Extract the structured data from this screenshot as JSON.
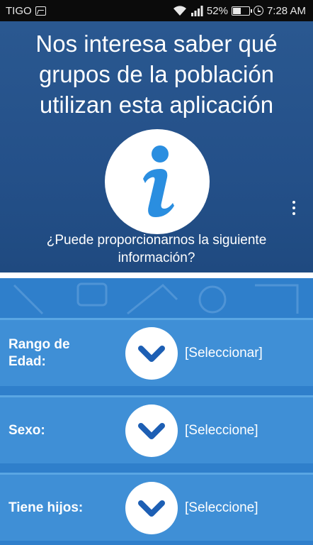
{
  "status_bar": {
    "carrier": "TIGO",
    "battery": "52%",
    "battery_level": 0.52,
    "time": "7:28 AM",
    "icons": [
      "image-icon",
      "wifi-icon",
      "signal-icon",
      "battery-icon",
      "clock-icon"
    ]
  },
  "header": {
    "title": "Nos interesa saber qué grupos de la población utilizan esta aplicación",
    "icon": "info-icon",
    "question": "¿Puede proporcionarnos la siguiente información?",
    "menu_icon": "overflow-menu-icon"
  },
  "form": {
    "rows": [
      {
        "label": "Rango de Edad:",
        "value": "[Seleccionar]",
        "icon": "chevron-down-icon"
      },
      {
        "label": "Sexo:",
        "value": "[Seleccione]",
        "icon": "chevron-down-icon"
      },
      {
        "label": "Tiene hijos:",
        "value": "[Seleccione]",
        "icon": "chevron-down-icon"
      }
    ]
  },
  "colors": {
    "header_bg": "#2a5890",
    "form_bg": "#3f8fd6",
    "accent": "#2a8ee0",
    "chevron": "#1d5fb4"
  }
}
